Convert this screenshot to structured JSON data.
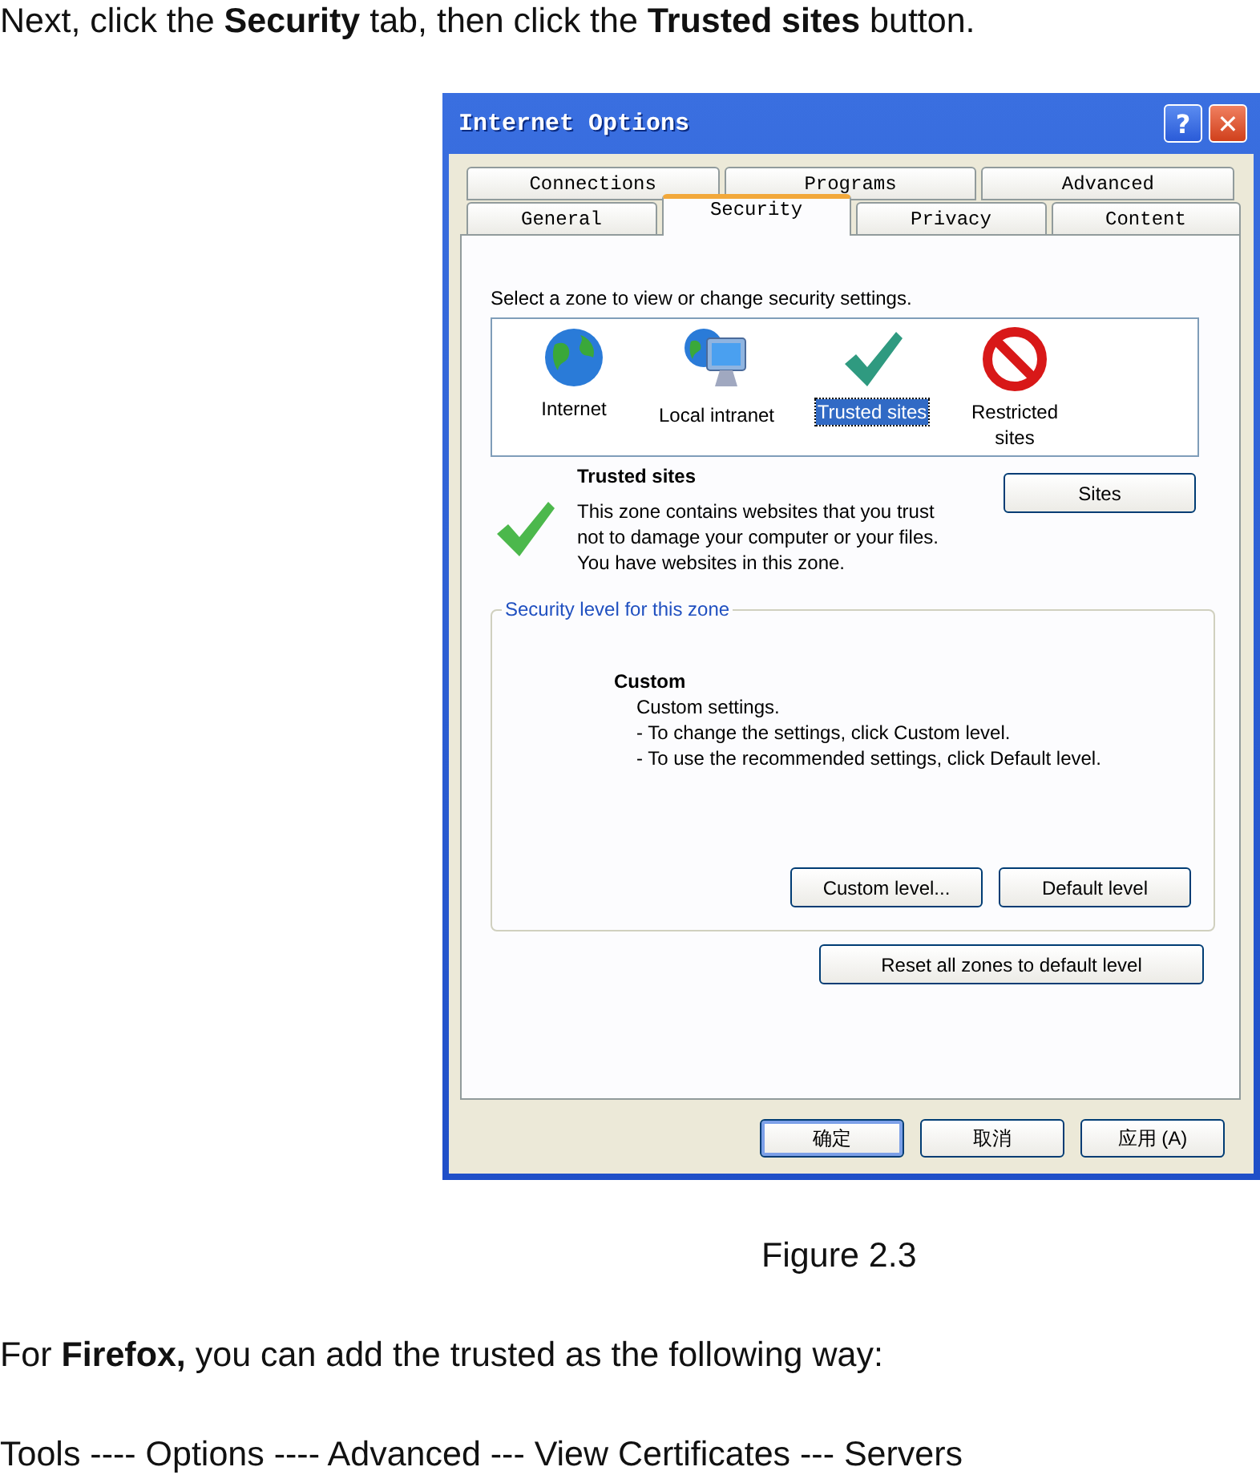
{
  "intro": "Next, click the **Security** tab, then click the **Trusted sites** button.",
  "window": {
    "title": "Internet Options",
    "help_glyph": "?",
    "close_glyph": "✕"
  },
  "tab_rows": [
    [
      {
        "label": "Connections",
        "selected": false
      },
      {
        "label": "Programs",
        "selected": false
      },
      {
        "label": "Advanced",
        "selected": false
      }
    ],
    [
      {
        "label": "General",
        "selected": false
      },
      {
        "label": "Security",
        "selected": true
      },
      {
        "label": "Privacy",
        "selected": false
      },
      {
        "label": "Content",
        "selected": false
      }
    ]
  ],
  "zone_prompt": "Select a zone to view or change security settings.",
  "zones": [
    {
      "label": "Internet",
      "kind": "globe",
      "selected": false
    },
    {
      "label": "Local intranet",
      "kind": "network",
      "selected": false
    },
    {
      "label": "Trusted sites",
      "kind": "check",
      "selected": true
    },
    {
      "label": "Restricted sites",
      "kind": "blocked",
      "selected": false
    }
  ],
  "zone_info": {
    "title": "Trusted sites",
    "description": "This zone contains websites that you trust not to damage your computer or your files.",
    "status": "You have websites in this zone.",
    "sites_button": "Sites"
  },
  "security_level": {
    "legend": "Security level for this zone",
    "name": "Custom",
    "lines": [
      "Custom settings.",
      "- To change the settings, click Custom level.",
      "- To use the recommended settings, click Default level."
    ],
    "buttons": [
      "Custom level...",
      "Default level"
    ]
  },
  "reset_button": "Reset all zones to default level",
  "dialog_buttons": [
    {
      "label": "确定",
      "default": true
    },
    {
      "label": "取消",
      "default": false
    },
    {
      "label": "应用 (A)",
      "default": false
    }
  ],
  "caption": "Figure 2.3",
  "firefox_note": "For **Firefox,** you can add the trusted as the following way:",
  "path": "Tools ---- Options ---- Advanced --- View Certificates --- Servers"
}
